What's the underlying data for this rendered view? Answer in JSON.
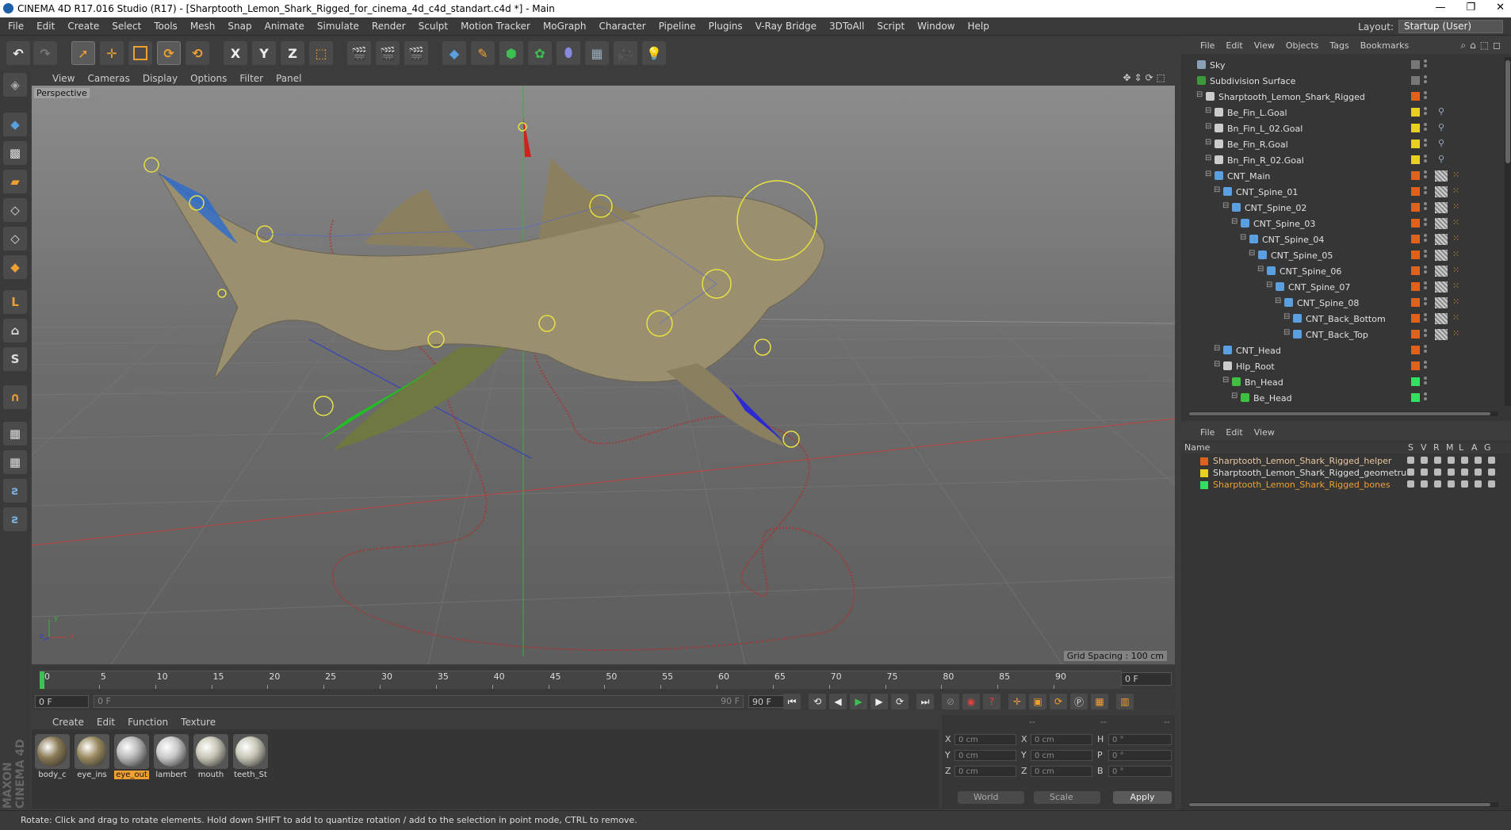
{
  "window": {
    "title": "CINEMA 4D R17.016 Studio (R17) - [Sharptooth_Lemon_Shark_Rigged_for_cinema_4d_c4d_standart.c4d *] - Main",
    "minimize": "—",
    "restore": "❐",
    "close": "✕"
  },
  "menu": [
    "File",
    "Edit",
    "Create",
    "Select",
    "Tools",
    "Mesh",
    "Snap",
    "Animate",
    "Simulate",
    "Render",
    "Sculpt",
    "Motion Tracker",
    "MoGraph",
    "Character",
    "Pipeline",
    "Plugins",
    "V-Ray Bridge",
    "3DToAll",
    "Script",
    "Window",
    "Help"
  ],
  "layout": {
    "label": "Layout:",
    "value": "Startup (User)"
  },
  "toolbar": {
    "undo": "↶",
    "redo": "↷",
    "move": "✛",
    "rotate": "⟳",
    "x": "X",
    "y": "Y",
    "z": "Z"
  },
  "viewport": {
    "menu": [
      "View",
      "Cameras",
      "Display",
      "Options",
      "Filter",
      "Panel"
    ],
    "label": "Perspective",
    "grid_spacing": "Grid Spacing : 100 cm",
    "axis_x": "x",
    "axis_y": "y",
    "axis_z": "z"
  },
  "timeline": {
    "ticks": [
      "0",
      "5",
      "10",
      "15",
      "20",
      "25",
      "30",
      "35",
      "40",
      "45",
      "50",
      "55",
      "60",
      "65",
      "70",
      "75",
      "80",
      "85",
      "90"
    ],
    "current_frame": "0 F"
  },
  "transport": {
    "start": "0 F",
    "range_start": "0 F",
    "range_end": "90 F",
    "end": "90 F"
  },
  "material_manager": {
    "menu": [
      "Create",
      "Edit",
      "Function",
      "Texture"
    ],
    "materials": [
      {
        "name": "body_c",
        "color": "#8a7a55",
        "selected": false
      },
      {
        "name": "eye_ins",
        "color": "#9a8a60",
        "selected": false
      },
      {
        "name": "eye_out",
        "color": "#b8b8b8",
        "selected": true
      },
      {
        "name": "lambert",
        "color": "#c8c8c8",
        "selected": false
      },
      {
        "name": "mouth",
        "color": "#c6c6b6",
        "selected": false
      },
      {
        "name": "teeth_St",
        "color": "#c6c6b6",
        "selected": false
      }
    ]
  },
  "coordinates": {
    "headers": [
      "--",
      "--",
      "--"
    ],
    "rows": [
      {
        "a": "X",
        "av": "0 cm",
        "b": "X",
        "bv": "0 cm",
        "c": "H",
        "cv": "0 °"
      },
      {
        "a": "Y",
        "av": "0 cm",
        "b": "Y",
        "bv": "0 cm",
        "c": "P",
        "cv": "0 °"
      },
      {
        "a": "Z",
        "av": "0 cm",
        "b": "Z",
        "bv": "0 cm",
        "c": "B",
        "cv": "0 °"
      }
    ],
    "mode": "World",
    "type": "Scale",
    "apply": "Apply"
  },
  "object_manager": {
    "menu": [
      "File",
      "Edit",
      "View",
      "Objects",
      "Tags",
      "Bookmarks"
    ],
    "objects": [
      {
        "name": "Sky",
        "indent": 0,
        "icon": "#8aa0b8",
        "color": "#777"
      },
      {
        "name": "Subdivision Surface",
        "indent": 0,
        "icon": "#3c9a3c",
        "color": "#777"
      },
      {
        "name": "Sharptooth_Lemon_Shark_Rigged",
        "indent": 1,
        "icon": "#cccccc",
        "color": "#e06020"
      },
      {
        "name": "Be_Fin_L.Goal",
        "indent": 2,
        "icon": "#cccccc",
        "color": "#e8d020"
      },
      {
        "name": "Bn_Fin_L_02.Goal",
        "indent": 2,
        "icon": "#cccccc",
        "color": "#e8d020"
      },
      {
        "name": "Be_Fin_R.Goal",
        "indent": 2,
        "icon": "#cccccc",
        "color": "#e8d020"
      },
      {
        "name": "Bn_Fin_R_02.Goal",
        "indent": 2,
        "icon": "#cccccc",
        "color": "#e8d020"
      },
      {
        "name": "CNT_Main",
        "indent": 2,
        "icon": "#5aa0e0",
        "color": "#e06020"
      },
      {
        "name": "CNT_Spine_01",
        "indent": 3,
        "icon": "#5aa0e0",
        "color": "#e06020"
      },
      {
        "name": "CNT_Spine_02",
        "indent": 4,
        "icon": "#5aa0e0",
        "color": "#e06020"
      },
      {
        "name": "CNT_Spine_03",
        "indent": 5,
        "icon": "#5aa0e0",
        "color": "#e06020"
      },
      {
        "name": "CNT_Spine_04",
        "indent": 6,
        "icon": "#5aa0e0",
        "color": "#e06020"
      },
      {
        "name": "CNT_Spine_05",
        "indent": 7,
        "icon": "#5aa0e0",
        "color": "#e06020"
      },
      {
        "name": "CNT_Spine_06",
        "indent": 8,
        "icon": "#5aa0e0",
        "color": "#e06020"
      },
      {
        "name": "CNT_Spine_07",
        "indent": 9,
        "icon": "#5aa0e0",
        "color": "#e06020"
      },
      {
        "name": "CNT_Spine_08",
        "indent": 10,
        "icon": "#5aa0e0",
        "color": "#e06020"
      },
      {
        "name": "CNT_Back_Bottom",
        "indent": 11,
        "icon": "#5aa0e0",
        "color": "#e06020"
      },
      {
        "name": "CNT_Back_Top",
        "indent": 11,
        "icon": "#5aa0e0",
        "color": "#e06020"
      },
      {
        "name": "CNT_Head",
        "indent": 3,
        "icon": "#5aa0e0",
        "color": "#e06020"
      },
      {
        "name": "Hlp_Root",
        "indent": 3,
        "icon": "#cccccc",
        "color": "#e06020"
      },
      {
        "name": "Bn_Head",
        "indent": 4,
        "icon": "#40c040",
        "color": "#30e060"
      },
      {
        "name": "Be_Head",
        "indent": 5,
        "icon": "#40c040",
        "color": "#30e060"
      }
    ]
  },
  "layer_manager": {
    "menu": [
      "File",
      "Edit",
      "View"
    ],
    "columns": [
      "Name",
      "S",
      "V",
      "R",
      "M",
      "L",
      "A",
      "G"
    ],
    "layers": [
      {
        "name": "Sharptooth_Lemon_Shark_Rigged_helper",
        "color": "#e06020",
        "text": "#e8c8a0"
      },
      {
        "name": "Sharptooth_Lemon_Shark_Rigged_geometru",
        "color": "#e8d020",
        "text": "#e0e0e0"
      },
      {
        "name": "Sharptooth_Lemon_Shark_Rigged_bones",
        "color": "#30e060",
        "text": "#f0a030"
      }
    ]
  },
  "status": "Rotate: Click and drag to rotate elements. Hold down SHIFT to add to quantize rotation / add to the selection in point mode, CTRL to remove."
}
